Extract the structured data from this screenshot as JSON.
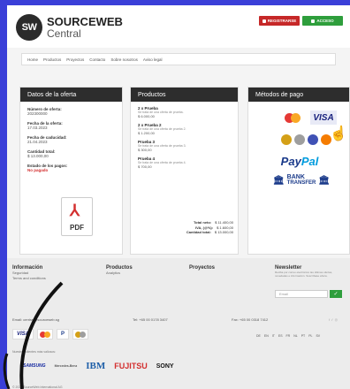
{
  "header": {
    "logo_mark": "SW",
    "brand_line1": "SOURCEWEB",
    "brand_line2": "Central",
    "register_label": "REGISTRARSE",
    "login_label": "ACCESO"
  },
  "nav": [
    "Home",
    "Productos",
    "Proyectos",
    "Contacto",
    "Sobre nosotros",
    "Aviso legal"
  ],
  "offer": {
    "title": "Datos de la oferta",
    "fields": [
      {
        "label": "Número de oferta:",
        "value": "202300000"
      },
      {
        "label": "Fecha de la oferta:",
        "value": "17.03.2023"
      },
      {
        "label": "Fecha de caducidad:",
        "value": "21.04.2023"
      },
      {
        "label": "Cantidad total:",
        "value": "$ 13.000,00"
      },
      {
        "label": "Estado de los pagos:",
        "value": "No pagado"
      }
    ],
    "pdf_label": "PDF"
  },
  "products": {
    "title": "Productos",
    "items": [
      {
        "name": "2 x Prueba",
        "desc": "Se trata de una oferta de prueba.",
        "price": "$ 6.000,00"
      },
      {
        "name": "2 x Prueba 2",
        "desc": "Se trata de una oferta de prueba 2.",
        "price": "$ 1.200,00"
      },
      {
        "name": "Prueba 3",
        "desc": "Se trata de una oferta de prueba 3.",
        "price": "$ 300,00"
      },
      {
        "name": "Prueba 4",
        "desc": "Se trata de una oferta de prueba 4.",
        "price": "$ 700,00"
      }
    ],
    "totals": [
      {
        "k": "Total neto:",
        "v": "$ 11.400,00"
      },
      {
        "k": "IVA, (@%):",
        "v": "$ 1.600,00"
      },
      {
        "k": "Cantidad total:",
        "v": "$ 13.000,00"
      }
    ]
  },
  "payment": {
    "title": "Métodos de pago",
    "visa": "VISA",
    "paypal_a": "Pay",
    "paypal_b": "Pal",
    "bank_1": "BANK",
    "bank_2": "TRANSFER"
  },
  "footer": {
    "info_title": "Información",
    "info_items": [
      "Seguridad",
      "Terms and conditions"
    ],
    "products_title": "Productos",
    "products_items": [
      "Analytics"
    ],
    "projects_title": "Proyectos",
    "newsletter_title": "Newsletter",
    "newsletter_text": "Reciba por correo electrónico las últimas ofertas, novedades e información. Suscríbase ahora.",
    "email_placeholder": "Email",
    "email_contact": "Email: central@sourceweb.sg",
    "tel": "Tel: +65 00 0178 3407",
    "fax": "Fax: +65 00 0318 7412",
    "langs": [
      "DE",
      "EN",
      "IT",
      "ES",
      "FR",
      "NL",
      "PT",
      "PL",
      "SV"
    ],
    "clients_text": "Nuestros clientes más valiosos:",
    "client_logos": [
      "SAMSUNG",
      "Mercedes-Benz",
      "IBM",
      "FUJITSU",
      "SONY"
    ],
    "copyright": "© 2023 SourceWeb International AG"
  }
}
